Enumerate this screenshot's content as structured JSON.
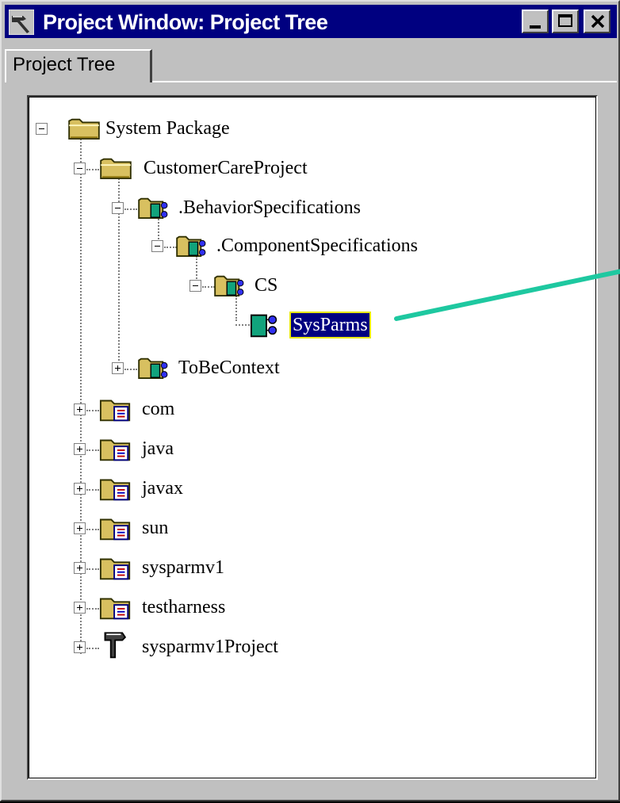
{
  "window": {
    "title": "Project Window: Project Tree",
    "title_icon": "hammer-icon",
    "controls": [
      "minimize-icon",
      "maximize-icon",
      "close-icon"
    ]
  },
  "tabs": [
    {
      "label": "Project Tree",
      "active": true
    }
  ],
  "tree": {
    "nodes": [
      {
        "label": "System Package",
        "icon": "folder-icon",
        "state": "expanded"
      },
      {
        "label": "CustomerCareProject",
        "icon": "folder-icon",
        "state": "expanded"
      },
      {
        "label": ".BehaviorSpecifications",
        "icon": "component-folder-icon",
        "state": "expanded"
      },
      {
        "label": ".ComponentSpecifications",
        "icon": "component-folder-icon",
        "state": "expanded"
      },
      {
        "label": "CS",
        "icon": "component-folder-icon",
        "state": "expanded"
      },
      {
        "label": "SysParms",
        "icon": "component-icon",
        "state": "leaf",
        "selected": true
      },
      {
        "label": "ToBeContext",
        "icon": "component-folder-icon",
        "state": "collapsed"
      },
      {
        "label": "com",
        "icon": "package-folder-icon",
        "state": "collapsed"
      },
      {
        "label": "java",
        "icon": "package-folder-icon",
        "state": "collapsed"
      },
      {
        "label": "javax",
        "icon": "package-folder-icon",
        "state": "collapsed"
      },
      {
        "label": "sun",
        "icon": "package-folder-icon",
        "state": "collapsed"
      },
      {
        "label": "sysparmv1",
        "icon": "package-folder-icon",
        "state": "collapsed"
      },
      {
        "label": "testharness",
        "icon": "package-folder-icon",
        "state": "collapsed"
      },
      {
        "label": "sysparmv1Project",
        "icon": "project-hammer-icon",
        "state": "collapsed"
      }
    ]
  },
  "colors": {
    "titlebar": "#000080",
    "selection": "#000080",
    "selection_outline": "#e8e800",
    "callout_arrow": "#1ec8a0",
    "component": "#11a37c"
  }
}
